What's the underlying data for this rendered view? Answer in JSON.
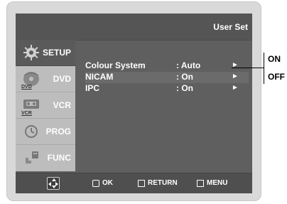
{
  "header": {
    "title": "User Set"
  },
  "sidebar": {
    "items": [
      {
        "label": "SETUP",
        "icon": "gear-icon",
        "active": true
      },
      {
        "label": "DVD",
        "icon": "dvd-icon",
        "active": false,
        "badge": "DVD"
      },
      {
        "label": "VCR",
        "icon": "vcr-icon",
        "active": false,
        "badge": "VCR"
      },
      {
        "label": "PROG",
        "icon": "clock-icon",
        "active": false
      },
      {
        "label": "FUNC",
        "icon": "hand-remote-icon",
        "active": false
      }
    ]
  },
  "menu": {
    "rows": [
      {
        "name": "Colour System",
        "value": ": Auto"
      },
      {
        "name": "NICAM",
        "value": ": On"
      },
      {
        "name": "IPC",
        "value": ": On"
      }
    ],
    "arrow_icon": "triangle-right-icon",
    "arrow_glyph": "►"
  },
  "footer": {
    "ok_label": "OK",
    "return_label": "RETURN",
    "menu_label": "MENU"
  },
  "callout": {
    "on_label": "ON",
    "off_label": "OFF"
  },
  "colors": {
    "screen_bg": "#5f5f5f",
    "sidebar_inactive": "#bdbdbd",
    "sidebar_active": "#5a5a5a",
    "text": "#ffffff"
  }
}
